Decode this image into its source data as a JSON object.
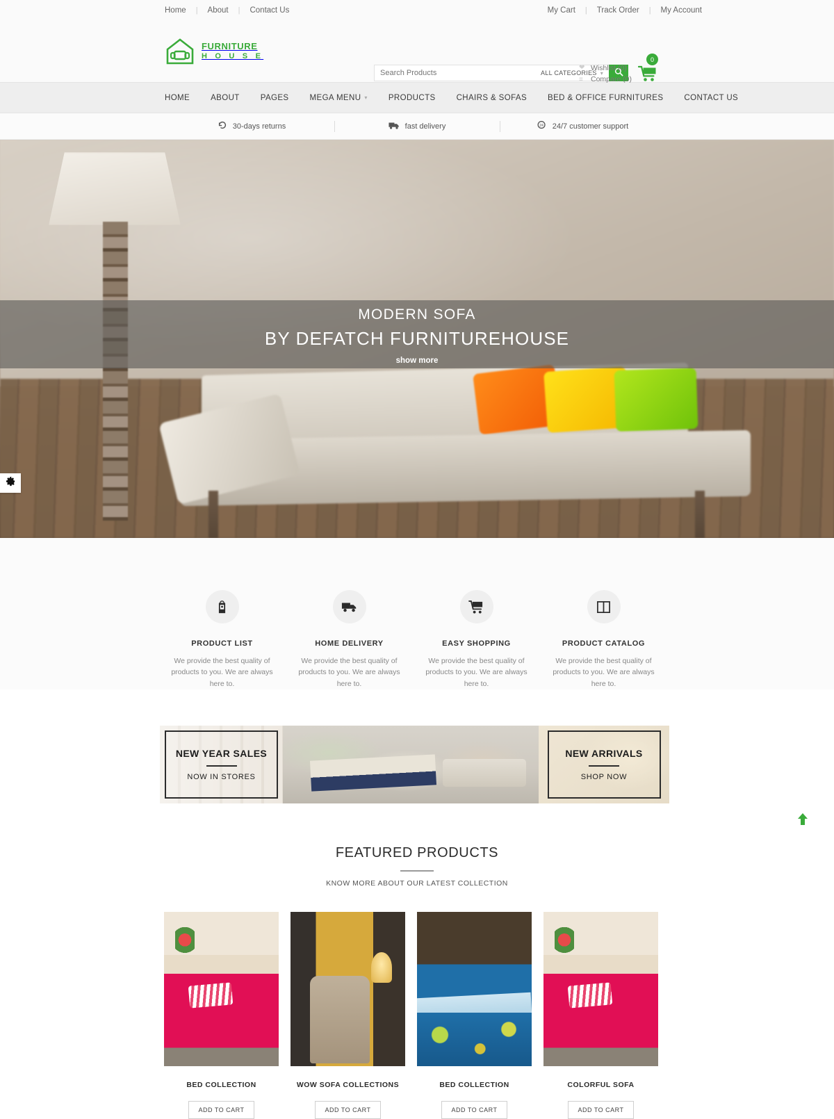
{
  "topbar": {
    "left_links": [
      "Home",
      "About",
      "Contact Us"
    ],
    "right_links": [
      "My Cart",
      "Track Order",
      "My Account"
    ],
    "separator": "|"
  },
  "header": {
    "logo": {
      "line1": "FURNITURE",
      "line2": "H O U S E",
      "color": "#3aab3a",
      "icon": "house-sofa-logo-icon"
    },
    "search": {
      "placeholder": "Search Products",
      "value": "",
      "category_label": "ALL CATEGORIES",
      "search_icon": "search-icon"
    },
    "wishlist_label": "Wishlist (0)",
    "compare_label": "Compare (0)",
    "cart_count": "0",
    "cart_icon": "shopping-cart-icon"
  },
  "nav": {
    "items": [
      {
        "label": "HOME",
        "has_caret": false
      },
      {
        "label": "ABOUT",
        "has_caret": false
      },
      {
        "label": "PAGES",
        "has_caret": false
      },
      {
        "label": "MEGA MENU",
        "has_caret": true
      },
      {
        "label": "PRODUCTS",
        "has_caret": false
      },
      {
        "label": "CHAIRS & SOFAS",
        "has_caret": false
      },
      {
        "label": "BED & OFFICE FURNITURES",
        "has_caret": false
      },
      {
        "label": "CONTACT US",
        "has_caret": false
      }
    ]
  },
  "feature_strip": [
    {
      "label": "30-days returns",
      "icon": "return-arrow-icon"
    },
    {
      "label": "fast delivery",
      "icon": "delivery-truck-icon"
    },
    {
      "label": "24/7 customer support",
      "icon": "24-7-support-icon"
    }
  ],
  "hero": {
    "title": "MODERN SOFA",
    "subtitle": "BY DEFATCH FURNITUREHOUSE",
    "cta": "show more",
    "thumbnails": [
      "slide-thumb-sofa",
      "slide-thumb-interior",
      "slide-thumb-white-sofa"
    ],
    "settings_icon": "gear-icon"
  },
  "services": [
    {
      "title": "PRODUCT LIST",
      "icon": "product-list-icon",
      "desc": "We provide the best quality of products to you. We are always here to."
    },
    {
      "title": "HOME DELIVERY",
      "icon": "delivery-truck-icon",
      "desc": "We provide the best quality of products to you. We are always here to."
    },
    {
      "title": "EASY SHOPPING",
      "icon": "shopping-cart-icon",
      "desc": "We provide the best quality of products to you. We are always here to."
    },
    {
      "title": "PRODUCT CATALOG",
      "icon": "catalog-book-icon",
      "desc": "We provide the best quality of products to you. We are always here to."
    }
  ],
  "promos": {
    "left": {
      "title": "NEW YEAR SALES",
      "subtitle": "NOW IN STORES"
    },
    "right": {
      "title": "NEW ARRIVALS",
      "subtitle": "SHOP NOW"
    }
  },
  "featured": {
    "title": "FEATURED PRODUCTS",
    "subtitle": "KNOW MORE ABOUT OUR LATEST COLLECTION",
    "products": [
      {
        "name": "BED COLLECTION",
        "button": "ADD TO CART"
      },
      {
        "name": "WOW SOFA COLLECTIONS",
        "button": "ADD TO CART"
      },
      {
        "name": "BED COLLECTION",
        "button": "ADD TO CART"
      },
      {
        "name": "COLORFUL SOFA",
        "button": "ADD TO CART"
      }
    ]
  },
  "scroll_top": {
    "icon": "arrow-up-icon",
    "color": "#3aab3a"
  }
}
